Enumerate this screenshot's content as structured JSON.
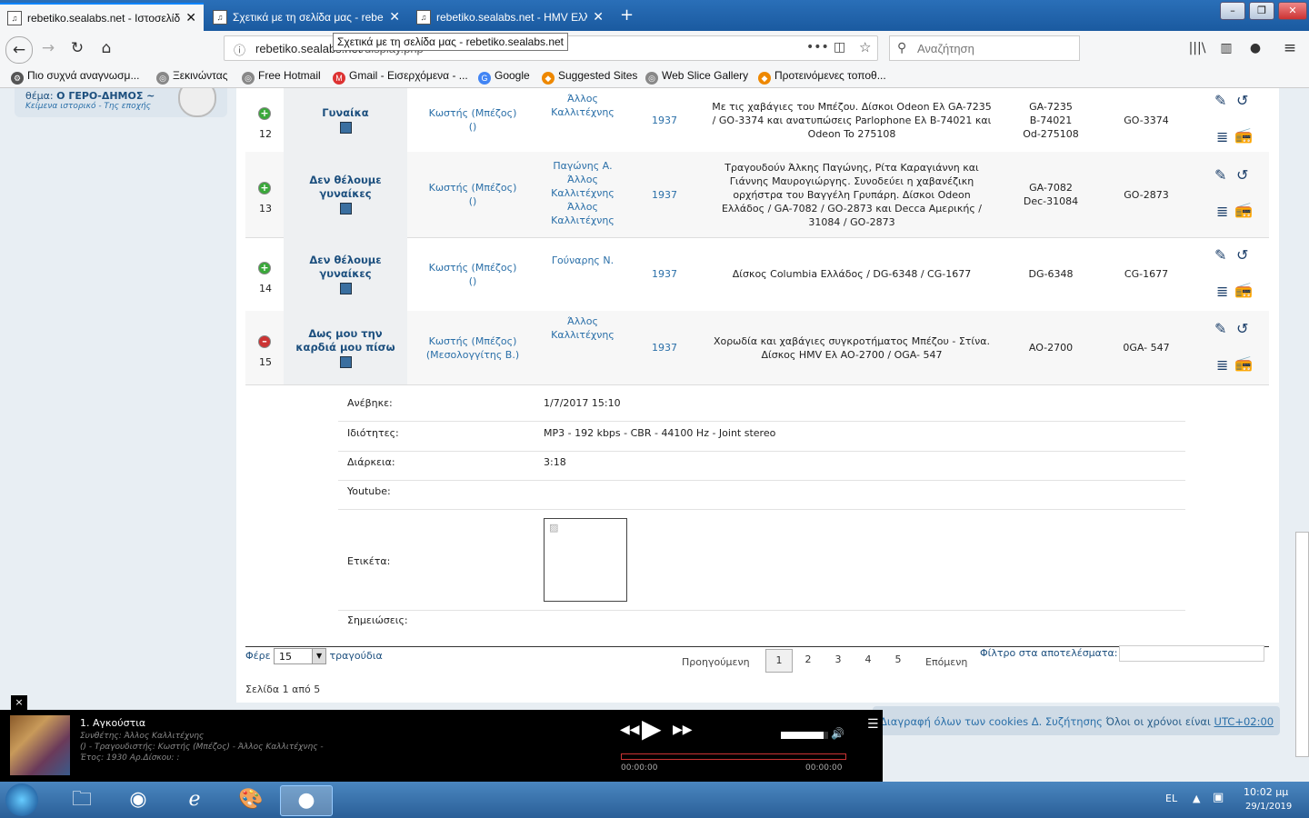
{
  "browser": {
    "tabs": [
      {
        "title": "rebetiko.sealabs.net - Ιστοσελίδ",
        "active": true
      },
      {
        "title": "Σχετικά με τη σελίδα μας - rebe",
        "active": false
      },
      {
        "title": "rebetiko.sealabs.net - HMV Ελλ",
        "active": false
      }
    ],
    "url_domain": "rebetiko.sealabs.net",
    "url_path": "/display.php",
    "search_placeholder": "Αναζήτηση",
    "tooltip": "Σχετικά με τη σελίδα μας - rebetiko.sealabs.net",
    "bookmarks": [
      "Πιο συχνά αναγνωσμ...",
      "Ξεκινώντας",
      "Free Hotmail",
      "Gmail - Εισερχόμενα - ...",
      "Google",
      "Suggested Sites",
      "Web Slice Gallery",
      "Προτεινόμενες τοποθ..."
    ]
  },
  "sidebar": {
    "theme_label": "θέμα:",
    "theme_value": "Ο ΓΕΡΟ-ΔΗΜΟΣ ~",
    "sub": "Κείμενα ιστορικό - Της εποχής"
  },
  "rows": [
    {
      "num": "12",
      "state": "plus",
      "title": "Γυναίκα",
      "singer": "Κωστής (Μπέζος)\n()",
      "composer": "Άλλος\nΚαλλιτέχνης",
      "year": "1937",
      "desc": "Με τις χαβάγιες του Μπέζου. Δίσκοι Odeon Ελ GA-7235\n/ GO-3374 και ανατυπώσεις Parlophone Ελ B-74021 και\nOdeon To 275108",
      "codes": "GA-7235\nB-74021\nOd-275108",
      "matrix": "GO-3374"
    },
    {
      "num": "13",
      "state": "plus",
      "title": "Δεν θέλουμε\nγυναίκες",
      "singer": "Κωστής (Μπέζος)\n()",
      "composer": "Παγώνης Α.\nΆλλος\nΚαλλιτέχνης\nΆλλος\nΚαλλιτέχνης",
      "year": "1937",
      "desc": "Τραγουδούν Άλκης Παγώνης, Ρίτα Καραγιάννη και\nΓιάννης Μαυρογιώργης. Συνοδεύει η χαβανέζικη\nορχήστρα του Βαγγέλη Γρυπάρη. Δίσκοι Odeon\nΕλλάδος / GA-7082 / GO-2873 και Decca Αμερικής /\n31084 / GO-2873",
      "codes": "GA-7082\nDec-31084",
      "matrix": "GO-2873"
    },
    {
      "num": "14",
      "state": "plus",
      "title": "Δεν θέλουμε\nγυναίκες",
      "singer": "Κωστής (Μπέζος)\n()",
      "composer": "Γούναρης Ν.",
      "year": "1937",
      "desc": "Δίσκος Columbia Ελλάδος / DG-6348 / CG-1677",
      "codes": "DG-6348",
      "matrix": "CG-1677"
    },
    {
      "num": "15",
      "state": "minus",
      "title": "Δως μου την\nκαρδιά μου πίσω",
      "singer": "Κωστής (Μπέζος)\n(Μεσολογγίτης Β.)",
      "composer": "Άλλος\nΚαλλιτέχνης",
      "year": "1937",
      "desc": "Χορωδία και χαβάγιες συγκροτήματος Μπέζου - Στίνα.\nΔίσκος HMV Ελ AO-2700 / OGA- 547",
      "codes": "AO-2700",
      "matrix": "0GA- 547"
    }
  ],
  "details": {
    "uploaded_label": "Ανέβηκε:",
    "uploaded_value": "1/7/2017 15:10",
    "props_label": "Ιδιότητες:",
    "props_value": "MP3 - 192 kbps - CBR - 44100 Hz - Joint stereo",
    "duration_label": "Διάρκεια:",
    "duration_value": "3:18",
    "youtube_label": "Youtube:",
    "label_label": "Ετικέτα:",
    "notes_label": "Σημειώσεις:"
  },
  "paging": {
    "show_label": "Φέρε",
    "per_page": "15",
    "songs_label": "τραγούδια",
    "prev": "Προηγούμενη",
    "pages": [
      "1",
      "2",
      "3",
      "4",
      "5"
    ],
    "current": "1",
    "next": "Επόμενη",
    "filter_label": "Φίλτρο στα αποτελέσματα:",
    "page_info": "Σελίδα 1 από 5"
  },
  "cookie_bar": {
    "link": "Διαγραφή όλων των cookies",
    "forum": "Δ. Συζήτησης",
    "tz_text": "Όλοι οι χρόνοι είναι",
    "tz": "UTC+02:00"
  },
  "player": {
    "track": "1. Αγκούστια",
    "composer_line": "Συνθέτης: Άλλος Καλλιτέχνης",
    "singer_line": "() - Τραγουδιστής: Κωστής (Μπέζος) - Άλλος Καλλιτέχνης -",
    "year_line": "Έτος: 1930 Αρ.Δίσκου: :",
    "time_current": "00:00:00",
    "time_total": "00:00:00",
    "close": "×",
    "progress": 0,
    "volume": 0.9
  },
  "taskbar": {
    "lang": "EL",
    "time": "10:02 μμ",
    "date": "29/1/2019"
  }
}
